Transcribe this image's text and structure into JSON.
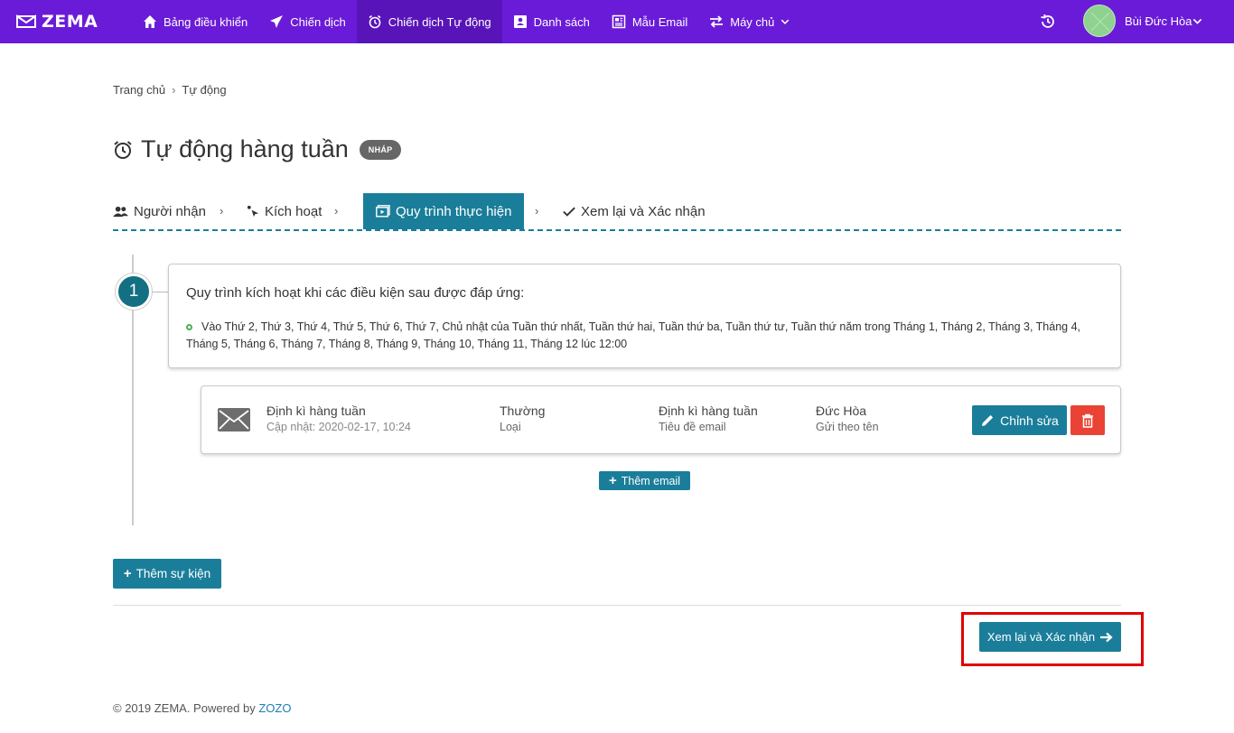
{
  "brand": {
    "name": "ZEMA",
    "logo_icon": "zema-logo-icon"
  },
  "nav": {
    "items": [
      {
        "label": "Bảng điều khiển",
        "icon": "home-icon"
      },
      {
        "label": "Chiến dịch",
        "icon": "send-icon"
      },
      {
        "label": "Chiến dịch Tự động",
        "icon": "alarm-clock-icon",
        "active": true
      },
      {
        "label": "Danh sách",
        "icon": "contacts-icon"
      },
      {
        "label": "Mẫu Email",
        "icon": "newspaper-icon"
      },
      {
        "label": "Máy chủ",
        "icon": "exchange-icon",
        "dropdown": true
      }
    ],
    "user_name": "Bùi Đức Hòa"
  },
  "breadcrumb": {
    "home": "Trang chủ",
    "separator": "›",
    "current": "Tự động"
  },
  "page": {
    "title": "Tự động hàng tuần",
    "badge": "NHÁP"
  },
  "steps": [
    {
      "label": "Người nhận",
      "icon": "users-icon"
    },
    {
      "label": "Kích hoạt",
      "icon": "pointer-icon"
    },
    {
      "label": "Quy trình thực hiện",
      "icon": "play-icon",
      "active": true
    },
    {
      "label": "Xem lại và Xác nhận",
      "icon": "check-icon"
    }
  ],
  "step_arrow": "›",
  "workflow": {
    "node_number": "1",
    "condition_title": "Quy trình kích hoạt khi các điều kiện sau được đáp ứng:",
    "condition_text": "Vào Thứ 2, Thứ 3, Thứ 4, Thứ 5, Thứ 6, Thứ 7, Chủ nhật của Tuần thứ nhất, Tuần thứ hai, Tuần thứ ba, Tuần thứ tư, Tuần thứ năm trong Tháng 1, Tháng 2, Tháng 3, Tháng 4, Tháng 5, Tháng 6, Tháng 7, Tháng 8, Tháng 9, Tháng 10, Tháng 11, Tháng 12 lúc 12:00",
    "email": {
      "name": "Định kì hàng tuần",
      "updated": "Cập nhật: 2020-02-17, 10:24",
      "type_value": "Thường",
      "type_label": "Loại",
      "subject_value": "Định kì hàng tuần",
      "subject_label": "Tiêu đề email",
      "sender_value": "Đức Hòa",
      "sender_label": "Gửi theo tên",
      "edit_label": "Chỉnh sửa"
    },
    "add_email_label": "Thêm email"
  },
  "add_event_label": "Thêm sự kiện",
  "review_button_label": "Xem lại và Xác nhận",
  "footer": {
    "text": "© 2019 ZEMA. Powered by",
    "link": "ZOZO"
  },
  "colors": {
    "nav_bg": "#6a1bd8",
    "primary": "#1a7e9a",
    "danger": "#ea4335",
    "highlight": "#e00000"
  }
}
